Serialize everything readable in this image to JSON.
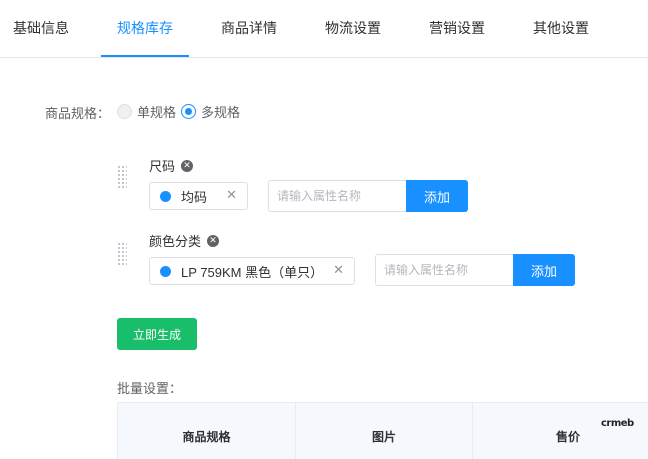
{
  "tabs": [
    {
      "label": "基础信息",
      "active": false
    },
    {
      "label": "规格库存",
      "active": true
    },
    {
      "label": "商品详情",
      "active": false
    },
    {
      "label": "物流设置",
      "active": false
    },
    {
      "label": "营销设置",
      "active": false
    },
    {
      "label": "其他设置",
      "active": false
    }
  ],
  "spec_form": {
    "label": "商品规格：",
    "options": [
      {
        "label": "单规格",
        "checked": false
      },
      {
        "label": "多规格",
        "checked": true
      }
    ]
  },
  "attributes": [
    {
      "name": "尺码",
      "values": [
        "均码"
      ],
      "input_placeholder": "请输入属性名称",
      "add_label": "添加"
    },
    {
      "name": "颜色分类",
      "values": [
        "LP 759KM 黑色（单只）"
      ],
      "input_placeholder": "请输入属性名称",
      "add_label": "添加"
    }
  ],
  "generate_label": "立即生成",
  "batch_label": "批量设置：",
  "table": {
    "headers": [
      "商品规格",
      "图片",
      "售价"
    ]
  },
  "watermark": "crmeb",
  "colors": {
    "accent": "#1890ff",
    "success": "#19be6b"
  },
  "icons": {
    "remove": "circle-x-icon",
    "close": "close-icon",
    "drag": "drag-handle-icon"
  }
}
